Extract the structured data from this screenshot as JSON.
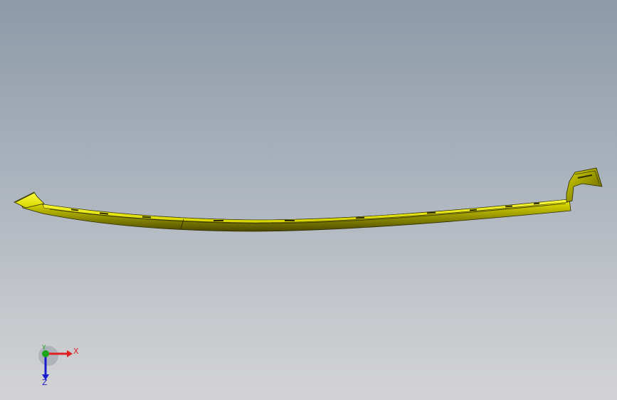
{
  "viewport": {
    "background_top": "#8e9aa8",
    "background_bottom": "#d3d3d5"
  },
  "model": {
    "part_color": "#e8e600",
    "edge_color": "#2a2a00"
  },
  "triad": {
    "x_label": "X",
    "y_label": "Y",
    "z_label": "Z",
    "x_color": "#e02020",
    "y_color": "#1aa51a",
    "z_color": "#1a1ad0"
  }
}
